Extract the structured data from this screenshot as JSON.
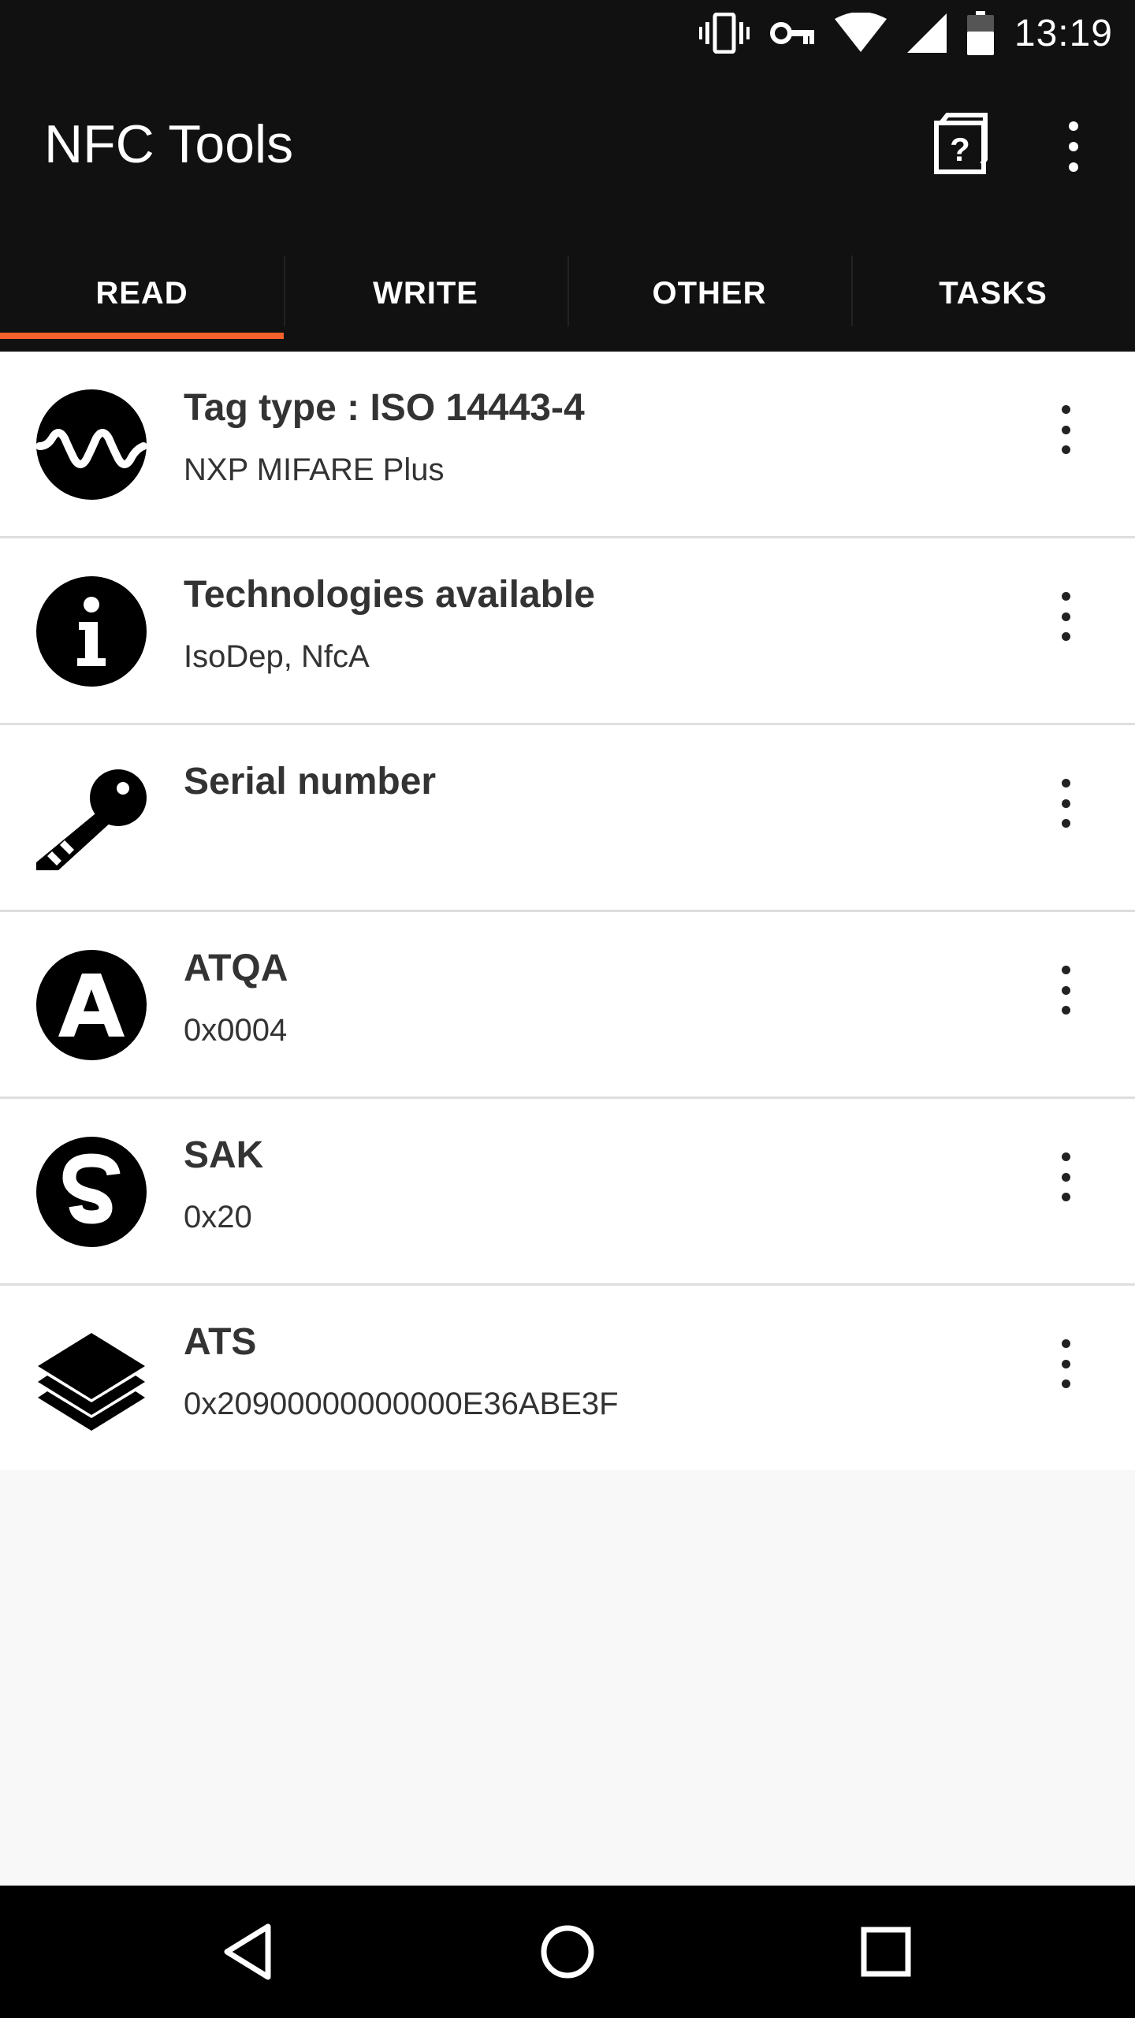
{
  "status_bar": {
    "time": "13:19",
    "icons": [
      "vibrate-icon",
      "vpn-key-icon",
      "wifi-icon",
      "signal-icon",
      "battery-icon"
    ]
  },
  "app_bar": {
    "title": "NFC Tools",
    "actions": [
      "help-icon",
      "overflow-menu-icon"
    ]
  },
  "tabs": [
    {
      "label": "READ",
      "selected": true
    },
    {
      "label": "WRITE",
      "selected": false
    },
    {
      "label": "OTHER",
      "selected": false
    },
    {
      "label": "TASKS",
      "selected": false
    }
  ],
  "items": [
    {
      "icon": "wave-icon",
      "title": "Tag type : ISO 14443-4",
      "subtitle": "NXP MIFARE Plus"
    },
    {
      "icon": "info-icon",
      "title": "Technologies available",
      "subtitle": "IsoDep, NfcA"
    },
    {
      "icon": "key-icon",
      "title": "Serial number",
      "subtitle": ""
    },
    {
      "icon": "letter-a-icon",
      "title": "ATQA",
      "subtitle": "0x0004"
    },
    {
      "icon": "letter-s-icon",
      "title": "SAK",
      "subtitle": "0x20"
    },
    {
      "icon": "layers-icon",
      "title": "ATS",
      "subtitle": "0x20900000000000E36ABE3F"
    }
  ],
  "nav_bar": [
    "back-icon",
    "home-icon",
    "recents-icon"
  ],
  "colors": {
    "bar_background": "#111111",
    "tab_indicator": "#f4622b",
    "list_background": "#ffffff",
    "page_background": "#f8f8f8",
    "text_primary": "#333333"
  }
}
